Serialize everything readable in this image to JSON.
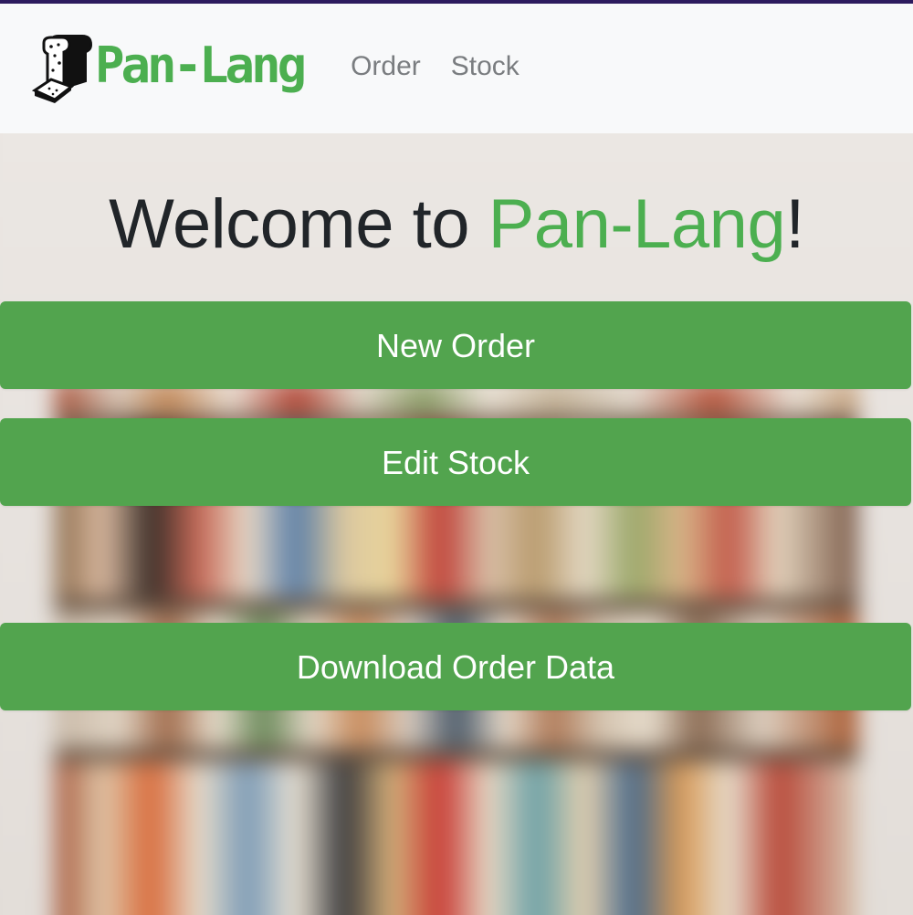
{
  "app": {
    "brand_name": "Pan-Lang",
    "accent_color": "#4caf50",
    "button_color": "#52a44e",
    "logo_icon": "bread-slice-icon"
  },
  "navbar": {
    "links": [
      {
        "label": "Order"
      },
      {
        "label": "Stock"
      }
    ]
  },
  "hero": {
    "welcome_prefix": "Welcome to ",
    "welcome_brand": "Pan-Lang",
    "welcome_suffix": "!",
    "background_image": "blurred-pantry-shelves"
  },
  "actions": {
    "new_order": "New Order",
    "edit_stock": "Edit Stock",
    "download_order_data": "Download Order Data"
  }
}
